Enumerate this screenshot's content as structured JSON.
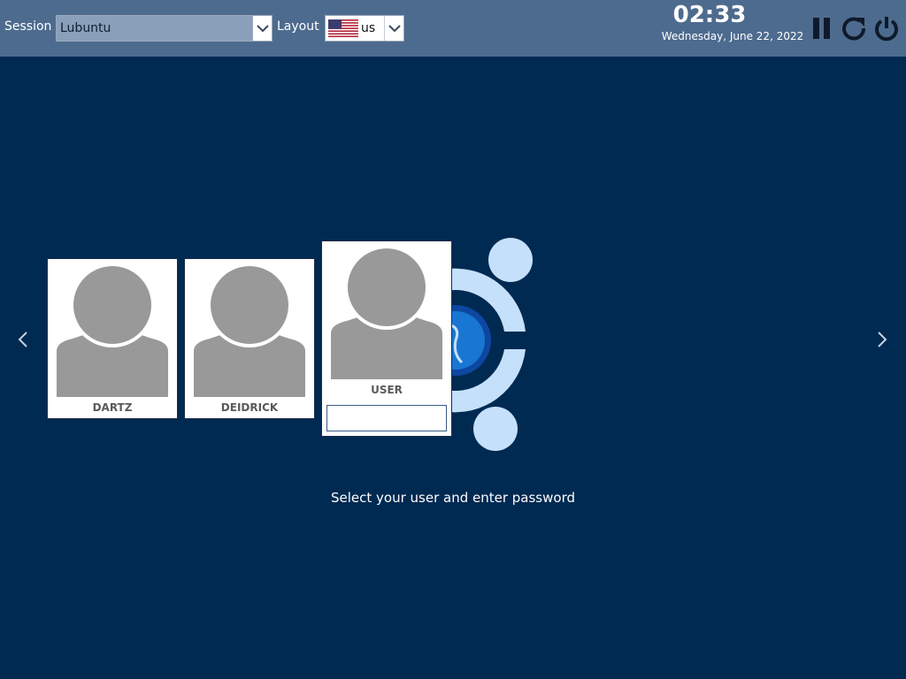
{
  "topbar": {
    "session_label": "Session",
    "session_value": "Lubuntu",
    "layout_label": "Layout",
    "layout_value": "us",
    "clock_time": "02:33",
    "clock_date": "Wednesday, June 22, 2022",
    "icons": {
      "session_arrow": "chevron-down-icon",
      "layout_arrow": "chevron-down-icon",
      "flag": "us-flag-icon",
      "suspend": "pause-icon",
      "reboot": "reboot-icon",
      "shutdown": "power-icon"
    }
  },
  "users": [
    {
      "name": "DARTZ"
    },
    {
      "name": "DEIDRICK"
    },
    {
      "name": "USER"
    }
  ],
  "password": {
    "value": "",
    "placeholder": ""
  },
  "status_message": "Select your user and enter password",
  "colors": {
    "background": "#002a52",
    "topbar": "#4d6b8e",
    "avatar_gray": "#999999",
    "logo_light": "#c5e0fb",
    "logo_blue": "#1565c0"
  }
}
